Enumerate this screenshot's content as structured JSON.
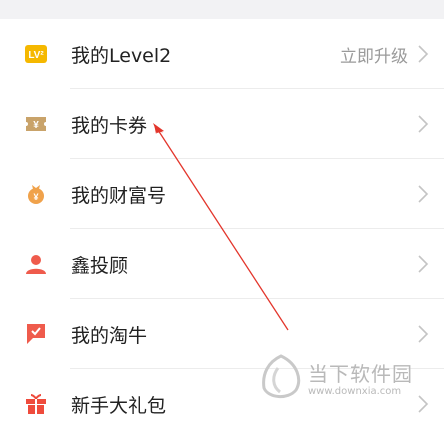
{
  "menu": {
    "items": [
      {
        "label": "我的Level2",
        "action_text": "立即升级",
        "icon": "level-badge-icon"
      },
      {
        "label": "我的卡券",
        "icon": "coupon-icon"
      },
      {
        "label": "我的财富号",
        "icon": "wealth-icon"
      },
      {
        "label": "鑫投顾",
        "icon": "advisor-icon"
      },
      {
        "label": "我的淘牛",
        "icon": "flag-icon"
      },
      {
        "label": "新手大礼包",
        "icon": "gift-icon"
      }
    ]
  },
  "watermark": {
    "title": "当下软件园",
    "url": "www.downxia.com"
  },
  "colors": {
    "level_badge": "#f5b800",
    "coupon": "#c9a36a",
    "wealth": "#f0a24b",
    "advisor": "#ef5b4c",
    "flag": "#ef5b4c",
    "gift": "#ef4b3c",
    "annotation_arrow": "#e3362c"
  }
}
